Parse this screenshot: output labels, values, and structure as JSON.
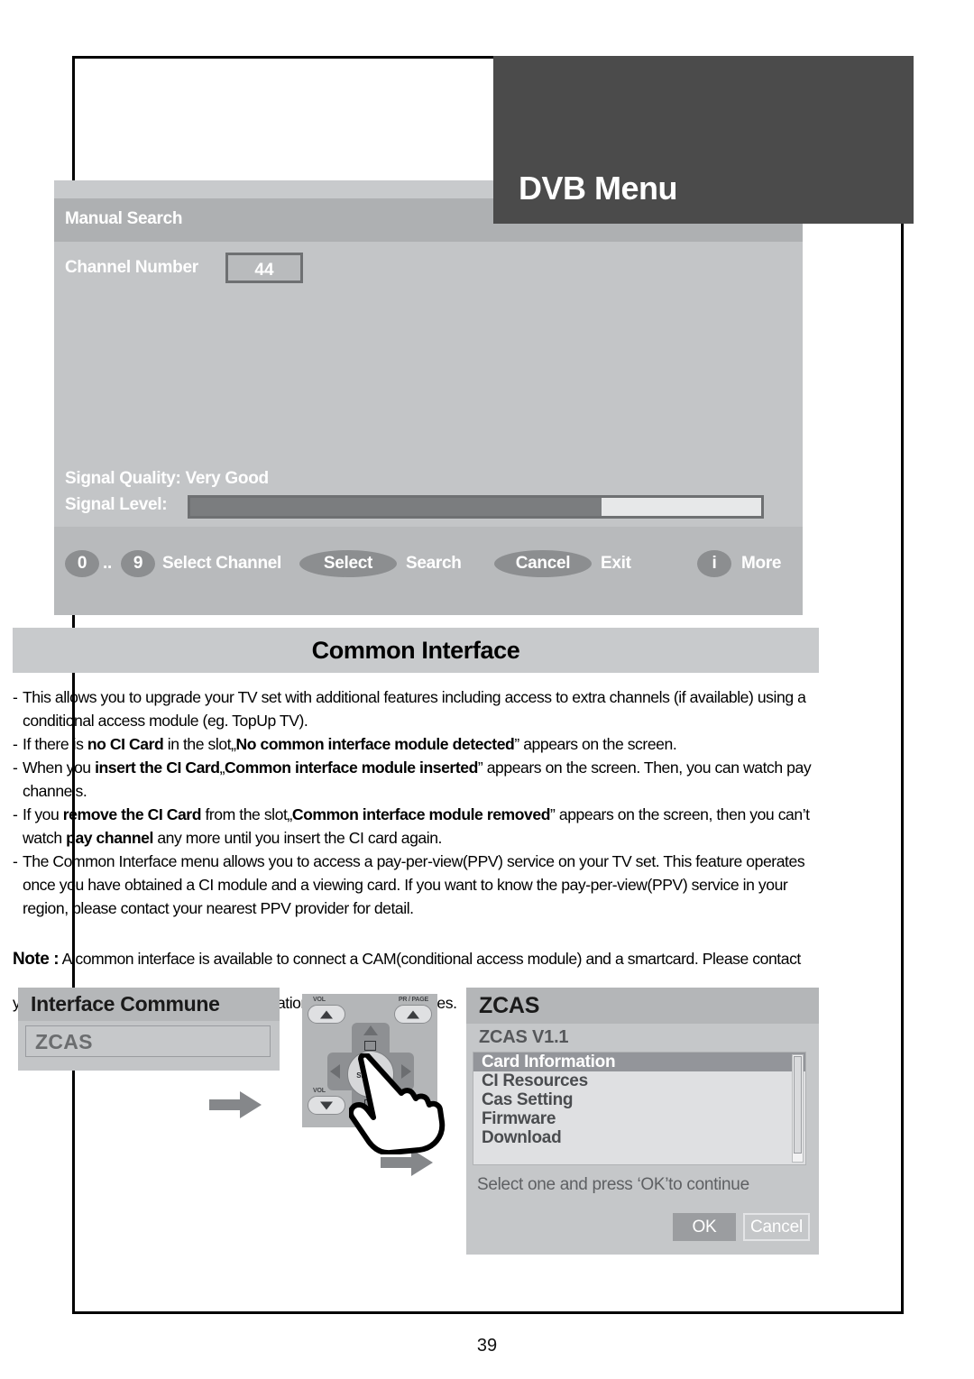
{
  "banner": {
    "title": "DVB Menu"
  },
  "osd": {
    "header_title": "Manual Search",
    "channel_number_label": "Channel Number",
    "channel_number_value": "44",
    "signal_quality": "Signal Quality: Very Good",
    "signal_level_label": "Signal Level:",
    "signal_level_percent": 72,
    "footer": {
      "key_0": "0",
      "dots": "..",
      "key_9": "9",
      "select_channel": "Select Channel",
      "select_pill": "Select",
      "search": "Search",
      "cancel_pill": "Cancel",
      "exit": "Exit",
      "info_pill": "i",
      "more": "More"
    }
  },
  "section": {
    "heading": "Common Interface",
    "bullets": [
      {
        "parts": [
          {
            "t": "This allows you to upgrade your TV set with additional features including access to extra channels (if available) using a conditional access module (eg. TopUp TV).",
            "b": false
          }
        ]
      },
      {
        "parts": [
          {
            "t": "If there is ",
            "b": false
          },
          {
            "t": "no CI Card",
            "b": true
          },
          {
            "t": " in the slot„",
            "b": false
          },
          {
            "t": "No common interface module detected",
            "b": true
          },
          {
            "t": "” appears on the screen.",
            "b": false
          }
        ]
      },
      {
        "parts": [
          {
            "t": "When you ",
            "b": false
          },
          {
            "t": "insert the CI Card",
            "b": true
          },
          {
            "t": "„",
            "b": false
          },
          {
            "t": "Common interface module inserted",
            "b": true
          },
          {
            "t": "” appears on the screen. Then, you can watch pay channels.",
            "b": false
          }
        ]
      },
      {
        "parts": [
          {
            "t": "If you ",
            "b": false
          },
          {
            "t": "remove the CI Card",
            "b": true
          },
          {
            "t": " from the slot„",
            "b": false
          },
          {
            "t": "Common interface module removed",
            "b": true
          },
          {
            "t": "” appears on the screen, then you can’t watch ",
            "b": false
          },
          {
            "t": "pay channel",
            "b": true
          },
          {
            "t": " any more until you insert the CI card again.",
            "b": false
          }
        ]
      },
      {
        "parts": [
          {
            "t": "The Common Interface menu allows you to access a pay-per-view(PPV) service on your TV set. This feature operates once you have obtained a CI module and a viewing card. If you want to know the pay-per-view(PPV) service in your region, please contact your nearest PPV provider for detail.",
            "b": false
          }
        ]
      }
    ],
    "note_label": "Note :",
    "note_text": " A common interface is available to connect a CAM(conditional access module) and a smartcard. Please contact your service provider to get more information about these modules."
  },
  "commune": {
    "title": "Interface Commune",
    "field_value": "ZCAS"
  },
  "remote": {
    "vol_up_label": "VOL",
    "vol_down_label": "VOL",
    "pr_page_label": "PR / PAGE",
    "ok_line1": "OK/",
    "ok_line2": "SELECT"
  },
  "zcas": {
    "title": "ZCAS",
    "version": "ZCAS V1.1",
    "items": [
      "Card Information",
      "CI Resources",
      "Cas Setting",
      "Firmware",
      "Download"
    ],
    "selected_index": 0,
    "hint": "Select one and press ‘OK’to continue",
    "ok_label": "OK",
    "cancel_label": "Cancel"
  },
  "page": {
    "number": "39"
  }
}
